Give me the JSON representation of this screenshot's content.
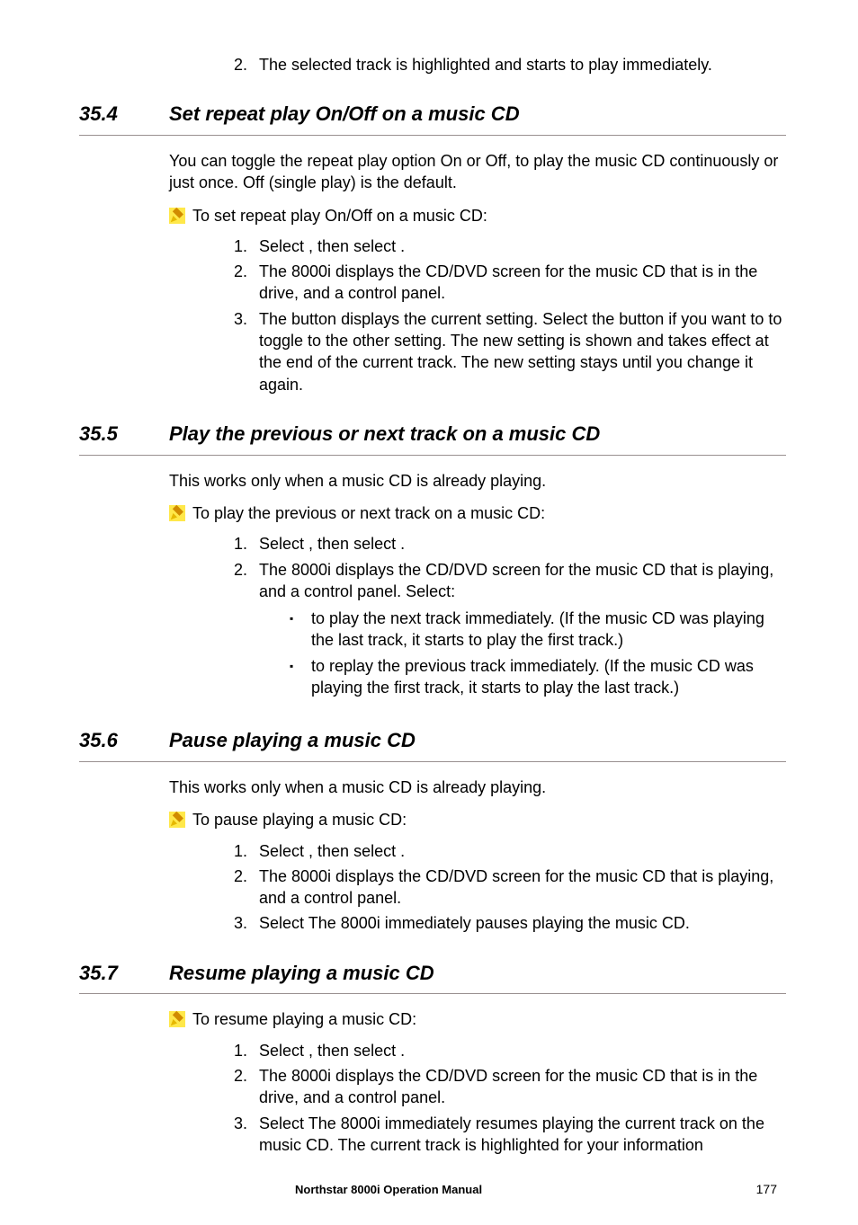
{
  "intro_step2": "The selected track is highlighted and starts to play immediately.",
  "sec354": {
    "num": "35.4",
    "title": "Set repeat play On/Off on a music CD",
    "intro": "You can toggle the repeat play option On or Off, to play the music CD continuously or just once. Off (single play) is the default.",
    "task": "To set repeat play On/Off on a music CD:",
    "steps": [
      "Select               , then select               .",
      "The 8000i displays the CD/DVD screen for the music CD that is in the drive, and a control panel.",
      "The                 button displays the current setting. Select the button if you want to to toggle to the other setting. The new setting is shown and takes effect at the end of the current track. The new setting stays until you change it again."
    ]
  },
  "sec355": {
    "num": "35.5",
    "title": "Play the previous or next track on a music CD",
    "intro": "This works only when a music CD is already playing.",
    "task": "To play the previous or next track on a music CD:",
    "steps": [
      "Select               , then select               .",
      "The 8000i displays the CD/DVD screen for the music CD that is playing, and a control panel. Select:"
    ],
    "bullets": [
      "           to play the next track immediately. (If the music CD was playing the last track, it starts to play the first track.)",
      "                   to replay the previous track immediately. (If the music CD was playing the first track, it starts to play the last track.)"
    ]
  },
  "sec356": {
    "num": "35.6",
    "title": "Pause playing a music CD",
    "intro": "This works only when a music CD is already playing.",
    "task": "To pause playing a music CD:",
    "steps": [
      "Select               , then select               .",
      "The 8000i displays the CD/DVD screen for the music CD that is playing, and a control panel.",
      "Select                 The 8000i immediately pauses playing the music CD."
    ]
  },
  "sec357": {
    "num": "35.7",
    "title": "Resume playing a music CD",
    "task": "To resume playing a music CD:",
    "steps": [
      "Select               , then select               .",
      "The 8000i displays the CD/DVD screen for the music CD that is in the drive, and a control panel.",
      "Select              The 8000i immediately resumes playing the current track on the music CD. The current track is highlighted for your information"
    ]
  },
  "footer": {
    "title": "Northstar 8000i Operation Manual",
    "page": "177"
  }
}
